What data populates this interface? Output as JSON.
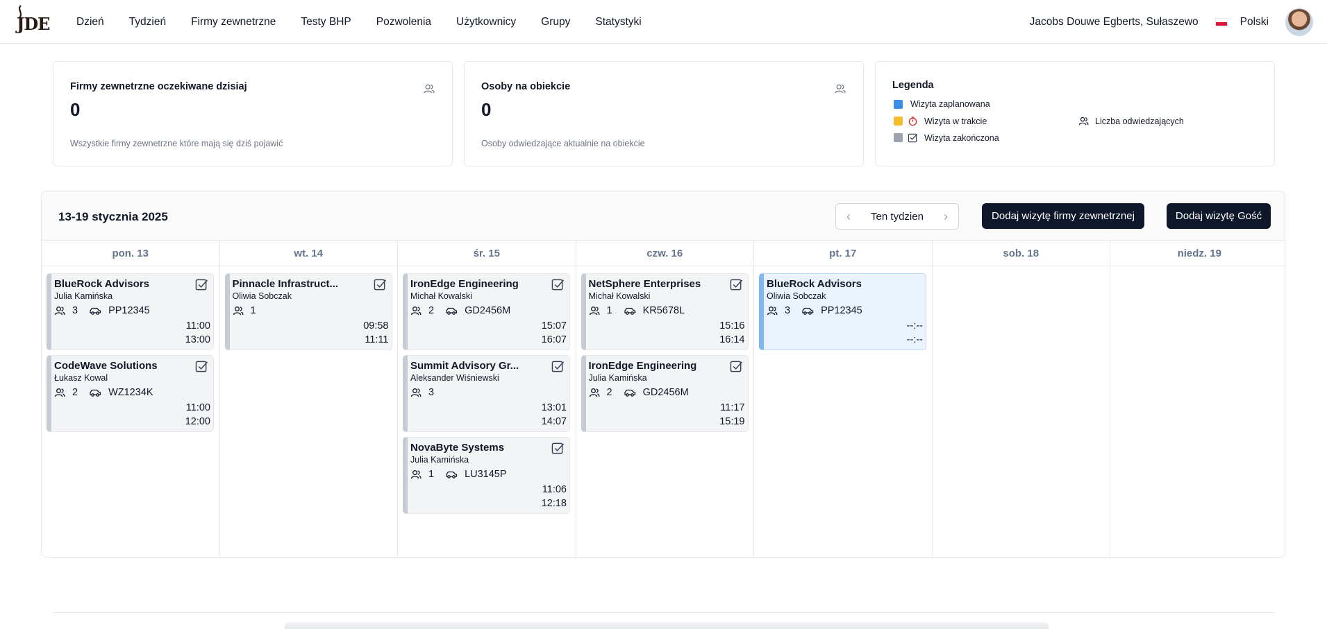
{
  "nav": {
    "logo_text": "JDE",
    "links": [
      "Dzień",
      "Tydzień",
      "Firmy zewnetrzne",
      "Testy BHP",
      "Pozwolenia",
      "Użytkownicy",
      "Grupy",
      "Statystyki"
    ],
    "company": "Jacobs Douwe Egberts, Sułaszewo",
    "language": "Polski"
  },
  "cards": {
    "companies": {
      "title": "Firmy zewnetrzne oczekiwane dzisiaj",
      "value": "0",
      "desc": "Wszystkie firmy zewnetrzne które mają się dziś pojawić",
      "icon": "users-icon"
    },
    "people": {
      "title": "Osoby na obiekcie",
      "value": "0",
      "desc": "Osoby odwiedzające aktualnie na obiekcie",
      "icon": "users-icon"
    }
  },
  "legend": {
    "title": "Legenda",
    "planned": "Wizyta zaplanowana",
    "in_progress": "Wizyta w trakcie",
    "finished": "Wizyta zakończona",
    "visitors": "Liczba odwiedzających",
    "colors": {
      "planned": "#3b8ee6",
      "in_progress": "#f5bd2e",
      "finished": "#9ca3af"
    }
  },
  "calendar": {
    "range": "13-19 stycznia 2025",
    "week_label": "Ten tydzien",
    "add_company_visit": "Dodaj wizytę firmy zewnetrznej",
    "add_guest_visit": "Dodaj wizytę Gość",
    "days": [
      {
        "label": "pon. 13",
        "visits": [
          {
            "name": "BlueRock Advisors",
            "person": "Julia Kamińska",
            "count": "3",
            "plate": "PP12345",
            "start": "11:00",
            "end": "13:00",
            "status": "finished"
          },
          {
            "name": "CodeWave Solutions",
            "person": "Łukasz Kowal",
            "count": "2",
            "plate": "WZ1234K",
            "start": "11:00",
            "end": "12:00",
            "status": "finished"
          }
        ]
      },
      {
        "label": "wt. 14",
        "visits": [
          {
            "name": "Pinnacle Infrastruct...",
            "person": "Oliwia Sobczak",
            "count": "1",
            "plate": "",
            "start": "09:58",
            "end": "11:11",
            "status": "finished"
          }
        ]
      },
      {
        "label": "śr. 15",
        "visits": [
          {
            "name": "IronEdge Engineering",
            "person": "Michał Kowalski",
            "count": "2",
            "plate": "GD2456M",
            "start": "15:07",
            "end": "16:07",
            "status": "finished"
          },
          {
            "name": "Summit Advisory Gr...",
            "person": "Aleksander Wiśniewski",
            "count": "3",
            "plate": "",
            "start": "13:01",
            "end": "14:07",
            "status": "finished"
          },
          {
            "name": "NovaByte Systems",
            "person": "Julia Kamińska",
            "count": "1",
            "plate": "LU3145P",
            "start": "11:06",
            "end": "12:18",
            "status": "finished"
          }
        ]
      },
      {
        "label": "czw. 16",
        "visits": [
          {
            "name": "NetSphere Enterprises",
            "person": "Michał Kowalski",
            "count": "1",
            "plate": "KR5678L",
            "start": "15:16",
            "end": "16:14",
            "status": "finished"
          },
          {
            "name": "IronEdge Engineering",
            "person": "Julia Kamińska",
            "count": "2",
            "plate": "GD2456M",
            "start": "11:17",
            "end": "15:19",
            "status": "finished"
          }
        ]
      },
      {
        "label": "pt. 17",
        "visits": [
          {
            "name": "BlueRock Advisors",
            "person": "Oliwia Sobczak",
            "count": "3",
            "plate": "PP12345",
            "start": "--:--",
            "end": "--:--",
            "status": "planned"
          }
        ]
      },
      {
        "label": "sob. 18",
        "visits": []
      },
      {
        "label": "niedz. 19",
        "visits": []
      }
    ]
  }
}
